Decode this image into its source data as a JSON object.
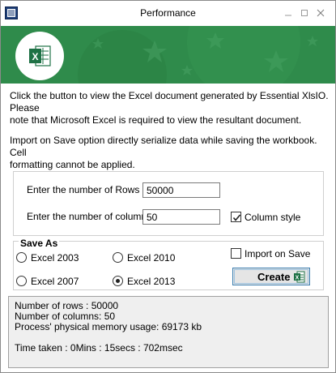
{
  "window": {
    "title": "Performance"
  },
  "description": {
    "line1a": "Click the button to view the Excel document generated by Essential XlsIO. Please",
    "line1b": "note that Microsoft Excel is required to view the resultant document.",
    "line2a": "Import on Save option directly serialize data while saving the workbook. Cell",
    "line2b": "formatting cannot be applied."
  },
  "inputs": {
    "rows_label": "Enter the number of Rows",
    "rows_value": "50000",
    "cols_label": "Enter the number of columns",
    "cols_value": "50",
    "column_style_label": "Column style",
    "column_style_checked": true
  },
  "save_as": {
    "title": "Save As",
    "options": [
      "Excel 2003",
      "Excel 2010",
      "Excel 2007",
      "Excel 2013"
    ],
    "selected": "Excel 2013",
    "import_on_save_label": "Import on Save",
    "import_on_save_checked": false,
    "create_label": "Create"
  },
  "output": {
    "rows": "Number of rows : 50000",
    "cols": "Number of columns: 50",
    "memory": "Process' physical memory usage: 69173 kb",
    "time": "Time taken : 0Mins : 15secs : 702msec"
  },
  "colors": {
    "banner": "#2e8a4a",
    "excel_green": "#1e7145"
  },
  "icons": [
    "app-document-icon",
    "minimize-icon",
    "maximize-icon",
    "close-icon",
    "excel-logo-icon",
    "check-icon",
    "excel-small-icon"
  ]
}
